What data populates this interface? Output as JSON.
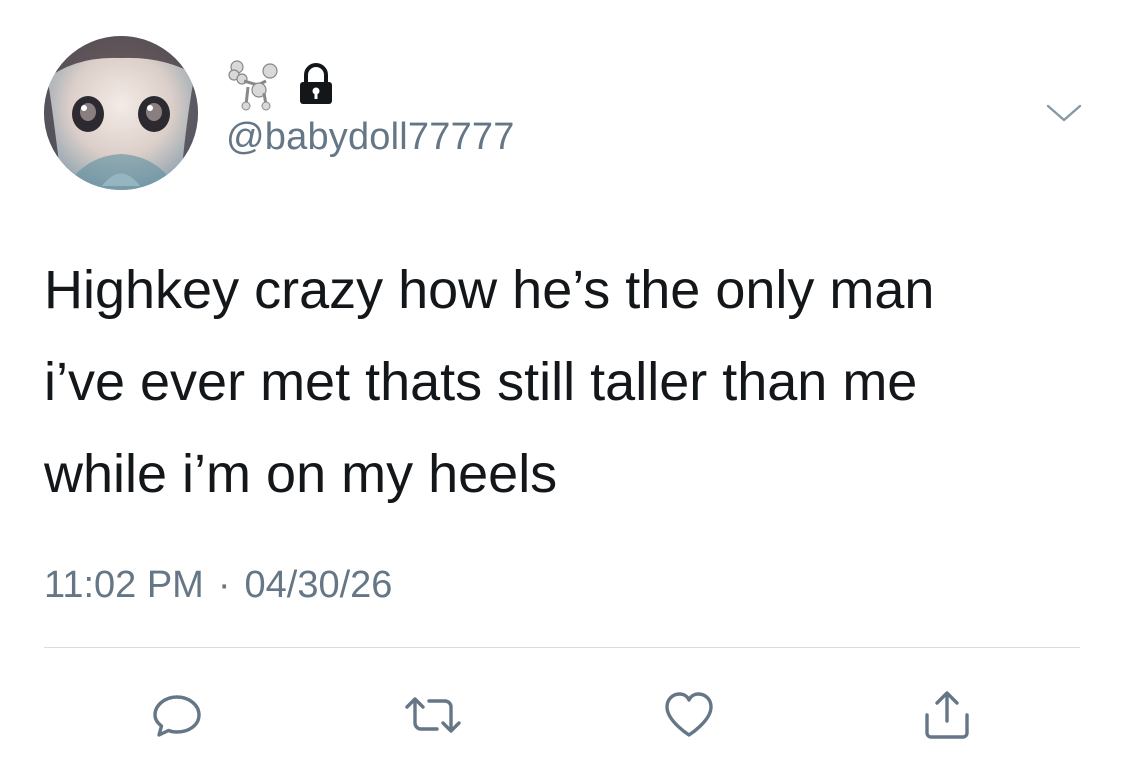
{
  "tweet": {
    "handle": "@babydoll77777",
    "display_name_emoji": [
      "poodle-icon",
      "lock-icon"
    ],
    "text": "Highkey crazy how he’s the only man\ni’ve ever met thats still taller than me\nwhile i’m on my heels",
    "time": "11:02 PM",
    "separator": "·",
    "date": "04/30/26"
  },
  "actions": [
    {
      "name": "reply",
      "icon": "reply-icon"
    },
    {
      "name": "retweet",
      "icon": "retweet-icon"
    },
    {
      "name": "like",
      "icon": "heart-icon"
    },
    {
      "name": "share",
      "icon": "share-icon"
    }
  ],
  "colors": {
    "text": "#14171a",
    "secondary": "#657786",
    "divider": "#d8dde1",
    "background": "#ffffff"
  }
}
